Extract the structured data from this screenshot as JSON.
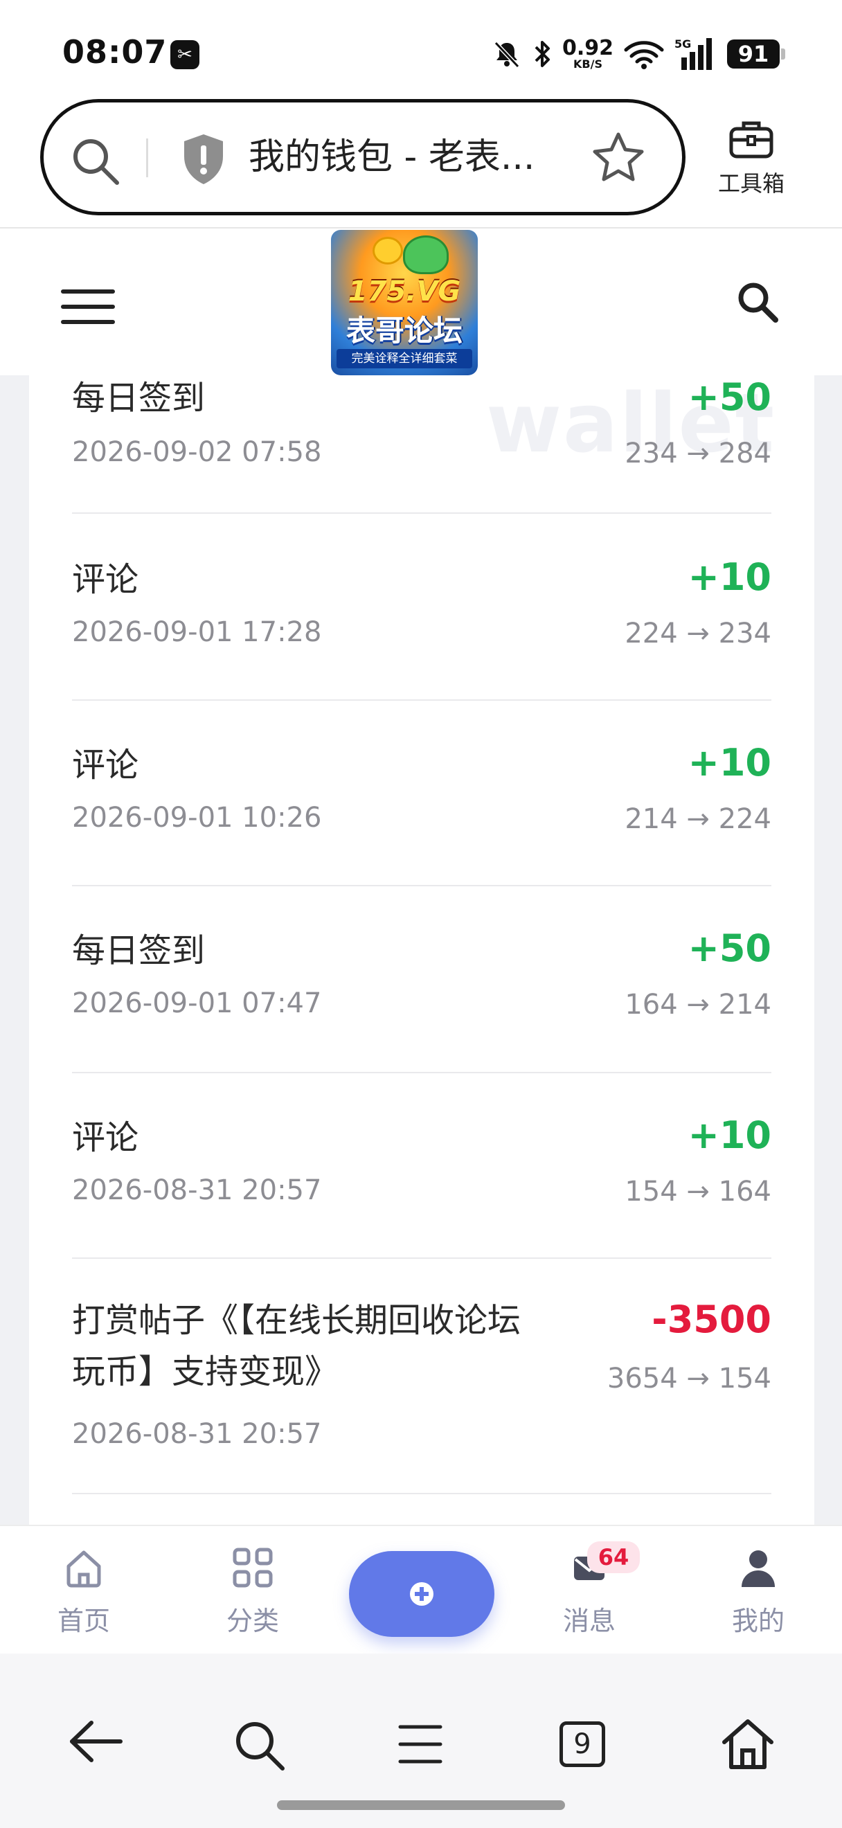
{
  "status_bar": {
    "time": "08:07",
    "app_icon": "capcut-icon",
    "net_speed_value": "0.92",
    "net_speed_unit": "KB/S",
    "network": "5G",
    "battery": "91"
  },
  "browser": {
    "address_text": "我的钱包 - 老表...",
    "toolbox_label": "工具箱",
    "tabs_count": "9"
  },
  "site": {
    "logo": {
      "title": "175.VG",
      "name": "表哥论坛",
      "tagline": "完美诠释全详细套菜"
    },
    "watermark": "wallet"
  },
  "entries": [
    {
      "title": "每日签到",
      "date": "2026-09-02 07:58",
      "amount": "+50",
      "balance": "234 → 284",
      "type": "positive"
    },
    {
      "title": "评论",
      "date": "2026-09-01 17:28",
      "amount": "+10",
      "balance": "224 → 234",
      "type": "positive"
    },
    {
      "title": "评论",
      "date": "2026-09-01 10:26",
      "amount": "+10",
      "balance": "214 → 224",
      "type": "positive"
    },
    {
      "title": "每日签到",
      "date": "2026-09-01 07:47",
      "amount": "+50",
      "balance": "164 → 214",
      "type": "positive"
    },
    {
      "title": "评论",
      "date": "2026-08-31 20:57",
      "amount": "+10",
      "balance": "154 → 164",
      "type": "positive"
    },
    {
      "title_line1": "打赏帖子《【在线长期回收论坛",
      "title_line2": "玩币】支持变现》",
      "date": "2026-08-31 20:57",
      "amount": "-3500",
      "balance": "3654 → 154",
      "type": "negative"
    }
  ],
  "bottom_nav": {
    "home": "首页",
    "category": "分类",
    "messages": "消息",
    "messages_badge": "64",
    "mine": "我的"
  },
  "colors": {
    "positive": "#1fb257",
    "negative": "#e41b3d",
    "accent": "#6179e8",
    "nav_text": "#8b8fa6"
  }
}
